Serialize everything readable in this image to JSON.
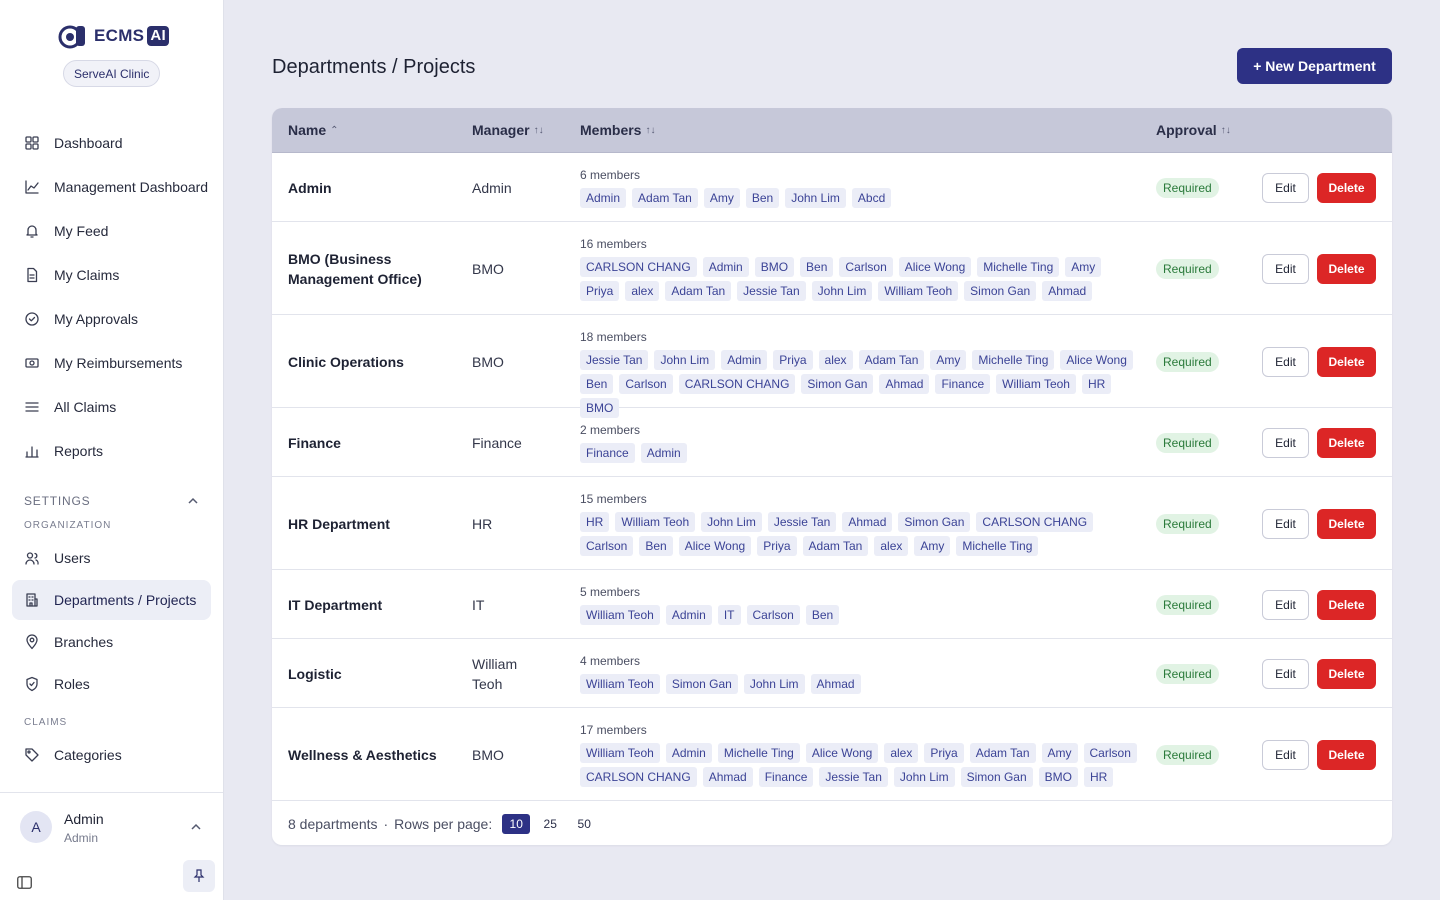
{
  "brand": {
    "logo_text": "ECMS",
    "logo_badge": "AI",
    "org_name": "ServeAI Clinic",
    "accent_color": "#2d3185"
  },
  "sidebar": {
    "main_items": [
      {
        "label": "Dashboard",
        "icon": "grid-icon"
      },
      {
        "label": "Management Dashboard",
        "icon": "line-chart-icon"
      },
      {
        "label": "My Feed",
        "icon": "bell-icon"
      },
      {
        "label": "My Claims",
        "icon": "document-icon"
      },
      {
        "label": "My Approvals",
        "icon": "check-circle-icon"
      },
      {
        "label": "My Reimbursements",
        "icon": "cash-icon"
      },
      {
        "label": "All Claims",
        "icon": "list-icon"
      },
      {
        "label": "Reports",
        "icon": "bar-chart-icon"
      }
    ],
    "settings_title": "SETTINGS",
    "organization_title": "ORGANIZATION",
    "org_items": [
      {
        "label": "Users",
        "icon": "users-icon"
      },
      {
        "label": "Departments / Projects",
        "icon": "building-icon"
      },
      {
        "label": "Branches",
        "icon": "map-pin-icon"
      },
      {
        "label": "Roles",
        "icon": "shield-icon"
      }
    ],
    "claims_title": "CLAIMS",
    "claims_items": [
      {
        "label": "Categories",
        "icon": "tag-icon"
      }
    ],
    "user": {
      "initial": "A",
      "name": "Admin",
      "role": "Admin"
    }
  },
  "main": {
    "title": "Departments / Projects",
    "new_button": "+ New Department",
    "columns": {
      "name": "Name",
      "manager": "Manager",
      "members": "Members",
      "approval": "Approval"
    },
    "edit_label": "Edit",
    "delete_label": "Delete",
    "rows": [
      {
        "name": "Admin",
        "manager": "Admin",
        "member_count": "6 members",
        "approval": "Required",
        "members": [
          "Admin",
          "Adam Tan",
          "Amy",
          "Ben",
          "John Lim",
          "Abcd"
        ]
      },
      {
        "name": "BMO (Business Management Office)",
        "manager": "BMO",
        "member_count": "16 members",
        "approval": "Required",
        "members": [
          "CARLSON CHANG",
          "Admin",
          "BMO",
          "Ben",
          "Carlson",
          "Alice Wong",
          "Michelle Ting",
          "Amy",
          "Priya",
          "alex",
          "Adam Tan",
          "Jessie Tan",
          "John Lim",
          "William Teoh",
          "Simon Gan",
          "Ahmad"
        ]
      },
      {
        "name": "Clinic Operations",
        "manager": "BMO",
        "member_count": "18 members",
        "approval": "Required",
        "members": [
          "Jessie Tan",
          "John Lim",
          "Admin",
          "Priya",
          "alex",
          "Adam Tan",
          "Amy",
          "Michelle Ting",
          "Alice Wong",
          "Ben",
          "Carlson",
          "CARLSON CHANG",
          "Simon Gan",
          "Ahmad",
          "Finance",
          "William Teoh",
          "HR",
          "BMO"
        ]
      },
      {
        "name": "Finance",
        "manager": "Finance",
        "member_count": "2 members",
        "approval": "Required",
        "members": [
          "Finance",
          "Admin"
        ]
      },
      {
        "name": "HR Department",
        "manager": "HR",
        "member_count": "15 members",
        "approval": "Required",
        "members": [
          "HR",
          "William Teoh",
          "John Lim",
          "Jessie Tan",
          "Ahmad",
          "Simon Gan",
          "CARLSON CHANG",
          "Carlson",
          "Ben",
          "Alice Wong",
          "Priya",
          "Adam Tan",
          "alex",
          "Amy",
          "Michelle Ting"
        ]
      },
      {
        "name": "IT Department",
        "manager": "IT",
        "member_count": "5 members",
        "approval": "Required",
        "members": [
          "William Teoh",
          "Admin",
          "IT",
          "Carlson",
          "Ben"
        ]
      },
      {
        "name": "Logistic",
        "manager": "William Teoh",
        "member_count": "4 members",
        "approval": "Required",
        "members": [
          "William Teoh",
          "Simon Gan",
          "John Lim",
          "Ahmad"
        ]
      },
      {
        "name": "Wellness & Aesthetics",
        "manager": "BMO",
        "member_count": "17 members",
        "approval": "Required",
        "members": [
          "William Teoh",
          "Admin",
          "Michelle Ting",
          "Alice Wong",
          "alex",
          "Priya",
          "Adam Tan",
          "Amy",
          "Carlson",
          "CARLSON CHANG",
          "Ahmad",
          "Finance",
          "Jessie Tan",
          "John Lim",
          "Simon Gan",
          "BMO",
          "HR"
        ]
      }
    ],
    "footer": {
      "count_text": "8 departments",
      "separator": "·",
      "rows_per_page_label": "Rows per page:",
      "page_sizes": [
        "10",
        "25",
        "50"
      ],
      "selected_page_size": "10"
    }
  }
}
